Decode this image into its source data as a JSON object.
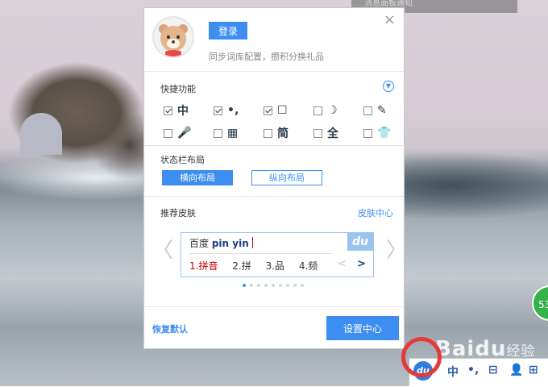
{
  "background": {
    "top_notice": "消息面板通知",
    "watermark_brand": "Bai",
    "watermark_suffix": "du",
    "watermark_text": "经验",
    "badge": "53"
  },
  "panel": {
    "close_label": "×",
    "login_label": "登录",
    "sync_tip": "同步词库配置，攒积分换礼品",
    "quick": {
      "title": "快捷功能",
      "items": [
        {
          "checked": true,
          "icon": "中"
        },
        {
          "checked": true,
          "icon": "•,"
        },
        {
          "checked": true,
          "icon": "☐"
        },
        {
          "checked": false,
          "icon": "☽"
        },
        {
          "checked": false,
          "icon": "✎"
        },
        {
          "checked": false,
          "icon": "🎤"
        },
        {
          "checked": false,
          "icon": "▦"
        },
        {
          "checked": false,
          "icon": "简"
        },
        {
          "checked": false,
          "icon": "全"
        },
        {
          "checked": false,
          "icon": "👕"
        }
      ]
    },
    "layout": {
      "title": "状态栏布局",
      "horizontal": "横向布局",
      "vertical": "纵向布局"
    },
    "skins": {
      "title": "推荐皮肤",
      "center_link": "皮肤中心",
      "prev_arrow": "〈",
      "next_arrow": "〉",
      "preview": {
        "prefix": "百度",
        "pinyin": "pin yin",
        "brand": "du",
        "candidates": [
          "1.拼音",
          "2.拼",
          "3.品",
          "4.频"
        ],
        "page_prev": "<",
        "page_next": ">"
      },
      "active_dot": 0
    },
    "restore_label": "恢复默认",
    "settings_label": "设置中心"
  },
  "taskbar": {
    "du_label": "du",
    "mode": "中",
    "punct": "•,",
    "toolbox": "⊟",
    "user": "👤",
    "grid": "⊞"
  },
  "colors": {
    "accent": "#3d8ef0",
    "highlight_ring": "#e53a3a",
    "candidate_first": "#cc0000"
  }
}
